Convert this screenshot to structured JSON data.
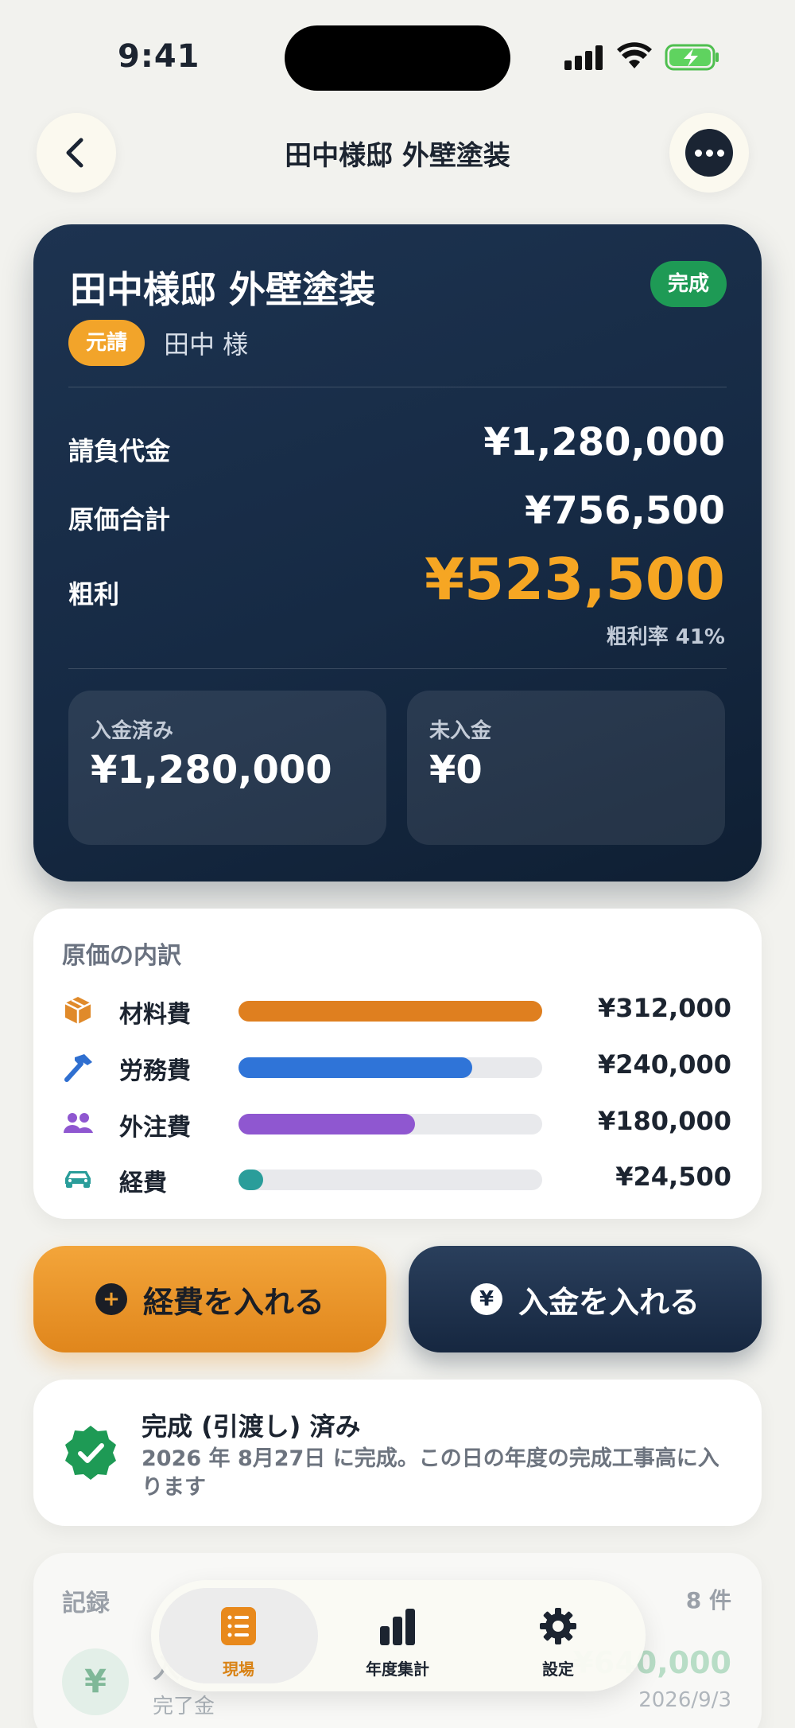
{
  "status_bar": {
    "time": "9:41"
  },
  "nav": {
    "title": "田中様邸 外壁塗装"
  },
  "project": {
    "title": "田中様邸 外壁塗装",
    "status_badge": "完成",
    "role_tag": "元請",
    "client": "田中 様"
  },
  "summary": {
    "contract_label": "請負代金",
    "contract_value": "¥1,280,000",
    "cost_label": "原価合計",
    "cost_value": "¥756,500",
    "profit_label": "粗利",
    "profit_value": "¥523,500",
    "profit_rate": "粗利率 41%",
    "received_label": "入金済み",
    "received_value": "¥1,280,000",
    "unpaid_label": "未入金",
    "unpaid_value": "¥0"
  },
  "cost_breakdown": {
    "title": "原価の内訳",
    "items": [
      {
        "label": "材料費",
        "value": "¥312,000",
        "amount": 312000,
        "fill": 1.0,
        "color": "#df7f1f",
        "icon": "box-icon"
      },
      {
        "label": "労務費",
        "value": "¥240,000",
        "amount": 240000,
        "fill": 0.77,
        "color": "#2f74d8",
        "icon": "hammer-icon"
      },
      {
        "label": "外注費",
        "value": "¥180,000",
        "amount": 180000,
        "fill": 0.58,
        "color": "#8f57d0",
        "icon": "people-icon"
      },
      {
        "label": "経費",
        "value": "¥24,500",
        "amount": 24500,
        "fill": 0.08,
        "color": "#2a9d9a",
        "icon": "car-icon"
      }
    ]
  },
  "actions": {
    "add_expense": "経費を入れる",
    "add_payment": "入金を入れる"
  },
  "completion": {
    "title": "完成 (引渡し) 済み",
    "desc": "2026 年 8月27日 に完成。この日の年度の完成工事高に入ります"
  },
  "records": {
    "title": "記録",
    "count": "8 件",
    "first": {
      "title": "入金",
      "subtitle": "完了金",
      "amount": "¥640,000",
      "date": "2026/9/3"
    }
  },
  "tabbar": {
    "tabs": [
      {
        "label": "現場",
        "active": true
      },
      {
        "label": "年度集計",
        "active": false
      },
      {
        "label": "設定",
        "active": false
      }
    ]
  },
  "colors": {
    "accent": "#f6a623",
    "navy": "#162a44",
    "success": "#1e9a55"
  }
}
